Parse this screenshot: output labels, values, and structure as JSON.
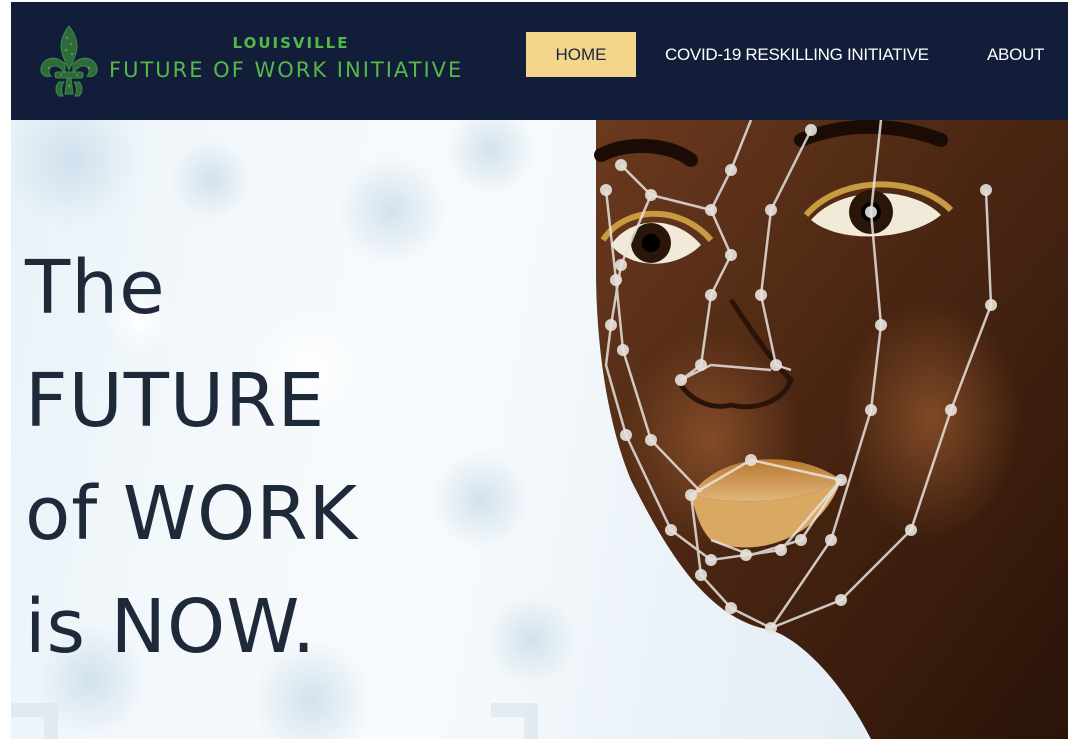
{
  "header": {
    "logo_top": "LOUISVILLE",
    "logo_bottom": "FUTURE OF WORK INITIATIVE",
    "logo_icon": "fleur-de-lis-icon"
  },
  "nav": {
    "items": [
      {
        "label": "HOME",
        "active": true
      },
      {
        "label": "COVID-19 RESKILLING INITIATIVE",
        "active": false
      },
      {
        "label": "ABOUT",
        "active": false
      }
    ]
  },
  "hero": {
    "headline_lines": [
      "The",
      "FUTURE",
      "of WORK",
      "is NOW."
    ]
  },
  "colors": {
    "header_bg": "#111d39",
    "logo_green": "#54b948",
    "active_nav_bg": "#f4d68b",
    "headline": "#1e2a3a"
  }
}
